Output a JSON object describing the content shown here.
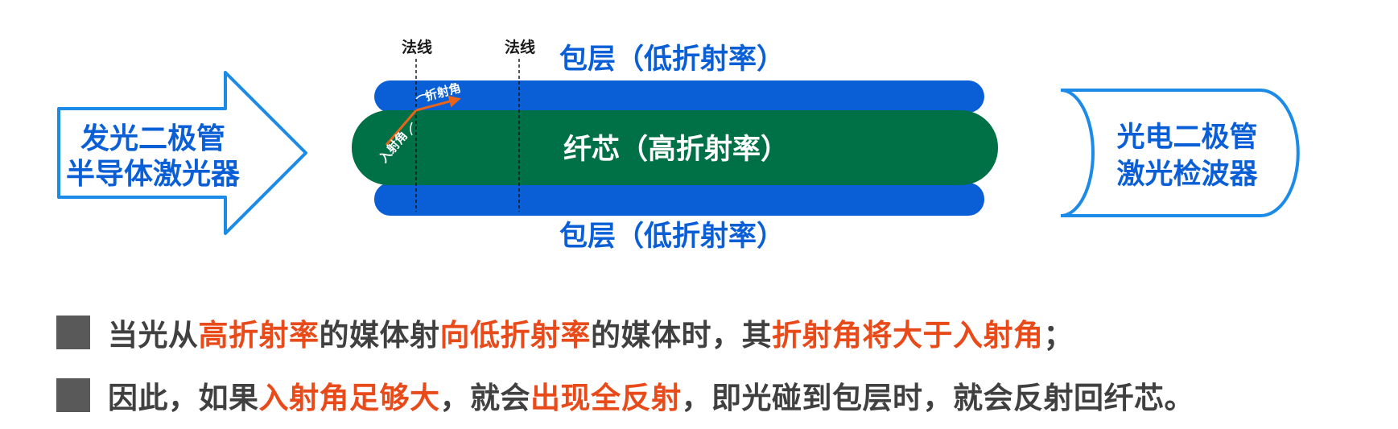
{
  "diagram": {
    "source": {
      "line1": "发光二极管",
      "line2": "半导体激光器"
    },
    "cladding_top": "包层（低折射率）",
    "cladding_bottom": "包层（低折射率）",
    "core": "纤芯（高折射率）",
    "normal_1": "法线",
    "normal_2": "法线",
    "refraction_angle": "折射角",
    "incidence_angle": "入射角",
    "detector": {
      "line1": "光电二极管",
      "line2": "激光检波器"
    },
    "colors": {
      "cladding": "#0a5fd6",
      "core": "#007146",
      "outline_blue": "#1c8be8",
      "label_blue": "#0a5fd6",
      "ray": "#e8641a",
      "highlight": "#e84a1a"
    }
  },
  "bullets": [
    {
      "segments": [
        {
          "text": "当光从",
          "highlight": false
        },
        {
          "text": "高折射率",
          "highlight": true
        },
        {
          "text": "的媒体射",
          "highlight": false
        },
        {
          "text": "向低折射率",
          "highlight": true
        },
        {
          "text": "的媒体时，其",
          "highlight": false
        },
        {
          "text": "折射角将大于入射角",
          "highlight": true
        },
        {
          "text": "；",
          "highlight": false
        }
      ]
    },
    {
      "segments": [
        {
          "text": "因此，如果",
          "highlight": false
        },
        {
          "text": "入射角足够大",
          "highlight": true
        },
        {
          "text": "，就会",
          "highlight": false
        },
        {
          "text": "出现全反射",
          "highlight": true
        },
        {
          "text": "，即光碰到包层时，就会反射回纤芯。",
          "highlight": false
        }
      ]
    }
  ]
}
